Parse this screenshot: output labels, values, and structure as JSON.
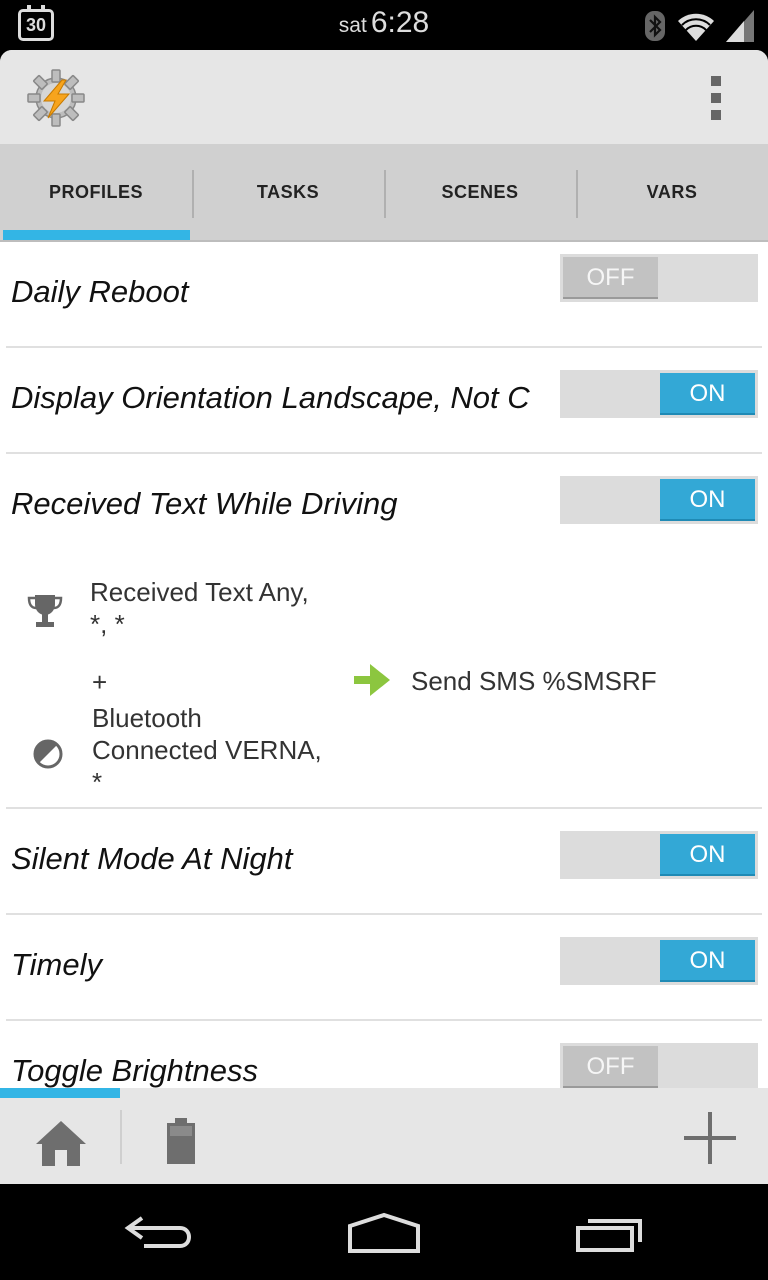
{
  "status_bar": {
    "calendar_day": "30",
    "day": "sat",
    "time": "6:28",
    "icons": [
      "bluetooth-icon",
      "wifi-icon",
      "signal-icon"
    ]
  },
  "app": {
    "logo_icon": "tasker-gear-lightning-icon",
    "menu_icon": "overflow-menu-icon"
  },
  "tabs": [
    {
      "label": "PROFILES",
      "active": true
    },
    {
      "label": "TASKS",
      "active": false
    },
    {
      "label": "SCENES",
      "active": false
    },
    {
      "label": "VARS",
      "active": false
    }
  ],
  "profiles": [
    {
      "name": "Daily Reboot",
      "state": "OFF"
    },
    {
      "name": "Display Orientation Landscape, Not C",
      "state": "ON"
    },
    {
      "name": "Received Text While Driving",
      "state": "ON",
      "contexts": {
        "event": "Received Text Any,\n*, *",
        "plus": "+",
        "state": "Bluetooth\nConnected VERNA,\n*"
      },
      "task": "Send SMS %SMSRF"
    },
    {
      "name": "Silent Mode At Night",
      "state": "ON"
    },
    {
      "name": "Timely",
      "state": "ON"
    },
    {
      "name": "Toggle Brightness",
      "state": "OFF"
    }
  ],
  "bottom_bar": {
    "icons": [
      "home-icon",
      "battery-icon",
      "add-icon"
    ]
  },
  "nav_bar": {
    "icons": [
      "back-icon",
      "home-nav-icon",
      "recents-icon"
    ]
  },
  "colors": {
    "accent": "#33b5e5",
    "toggle_on": "#33a8d6",
    "arrow": "#8cc63f"
  }
}
